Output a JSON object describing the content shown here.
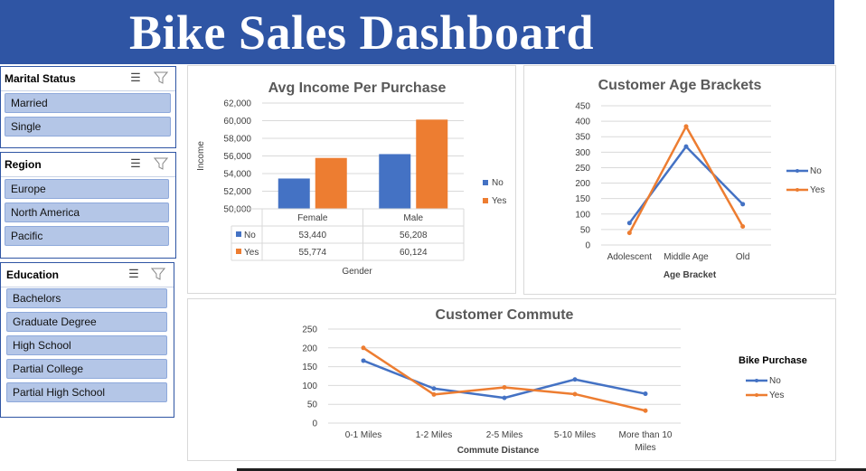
{
  "dashboard": {
    "title": "Bike Sales Dashboard"
  },
  "slicers": {
    "marital": {
      "title": "Marital Status",
      "items": [
        "Married",
        "Single"
      ]
    },
    "region": {
      "title": "Region",
      "items": [
        "Europe",
        "North America",
        "Pacific"
      ]
    },
    "education": {
      "title": "Education",
      "items": [
        "Bachelors",
        "Graduate Degree",
        "High School",
        "Partial College",
        "Partial High School"
      ]
    }
  },
  "colors": {
    "banner": "#2f55a4",
    "no": "#4472c4",
    "yes": "#ed7d31",
    "slicer_item": "#b4c6e7"
  },
  "chart_data": [
    {
      "type": "bar",
      "title": "Avg Income Per Purchase",
      "xlabel": "Gender",
      "ylabel": "Income",
      "categories": [
        "Female",
        "Male"
      ],
      "series": [
        {
          "name": "No",
          "values": [
            53440,
            56208
          ],
          "labels": [
            "53,440",
            "56,208"
          ]
        },
        {
          "name": "Yes",
          "values": [
            55774,
            60124
          ],
          "labels": [
            "55,774",
            "60,124"
          ]
        }
      ],
      "ylim": [
        50000,
        62000
      ],
      "yticks": [
        "50,000",
        "52,000",
        "54,000",
        "56,000",
        "58,000",
        "60,000",
        "62,000"
      ],
      "grid": true,
      "legend": "right",
      "data_table": true
    },
    {
      "type": "line",
      "title": "Customer Age Brackets",
      "xlabel": "Age Bracket",
      "ylabel": "",
      "categories": [
        "Adolescent",
        "Middle Age",
        "Old"
      ],
      "series": [
        {
          "name": "No",
          "values": [
            71,
            318,
            132
          ]
        },
        {
          "name": "Yes",
          "values": [
            39,
            383,
            60
          ]
        }
      ],
      "ylim": [
        0,
        450
      ],
      "yticks": [
        "0",
        "50",
        "100",
        "150",
        "200",
        "250",
        "300",
        "350",
        "400",
        "450"
      ],
      "grid": true,
      "legend": "right"
    },
    {
      "type": "line",
      "title": "Customer Commute",
      "xlabel": "Commute Distance",
      "ylabel": "",
      "categories": [
        "0-1 Miles",
        "1-2 Miles",
        "2-5 Miles",
        "5-10 Miles",
        "More than 10 Miles"
      ],
      "category_lines": [
        [
          "0-1 Miles"
        ],
        [
          "1-2 Miles"
        ],
        [
          "2-5 Miles"
        ],
        [
          "5-10 Miles"
        ],
        [
          "More than 10",
          "Miles"
        ]
      ],
      "series": [
        {
          "name": "No",
          "values": [
            166,
            92,
            67,
            116,
            78
          ]
        },
        {
          "name": "Yes",
          "values": [
            200,
            76,
            95,
            77,
            33
          ]
        }
      ],
      "ylim": [
        0,
        250
      ],
      "yticks": [
        "0",
        "50",
        "100",
        "150",
        "200",
        "250"
      ],
      "grid": true,
      "legend": "right",
      "legend_title": "Bike Purchase"
    }
  ]
}
